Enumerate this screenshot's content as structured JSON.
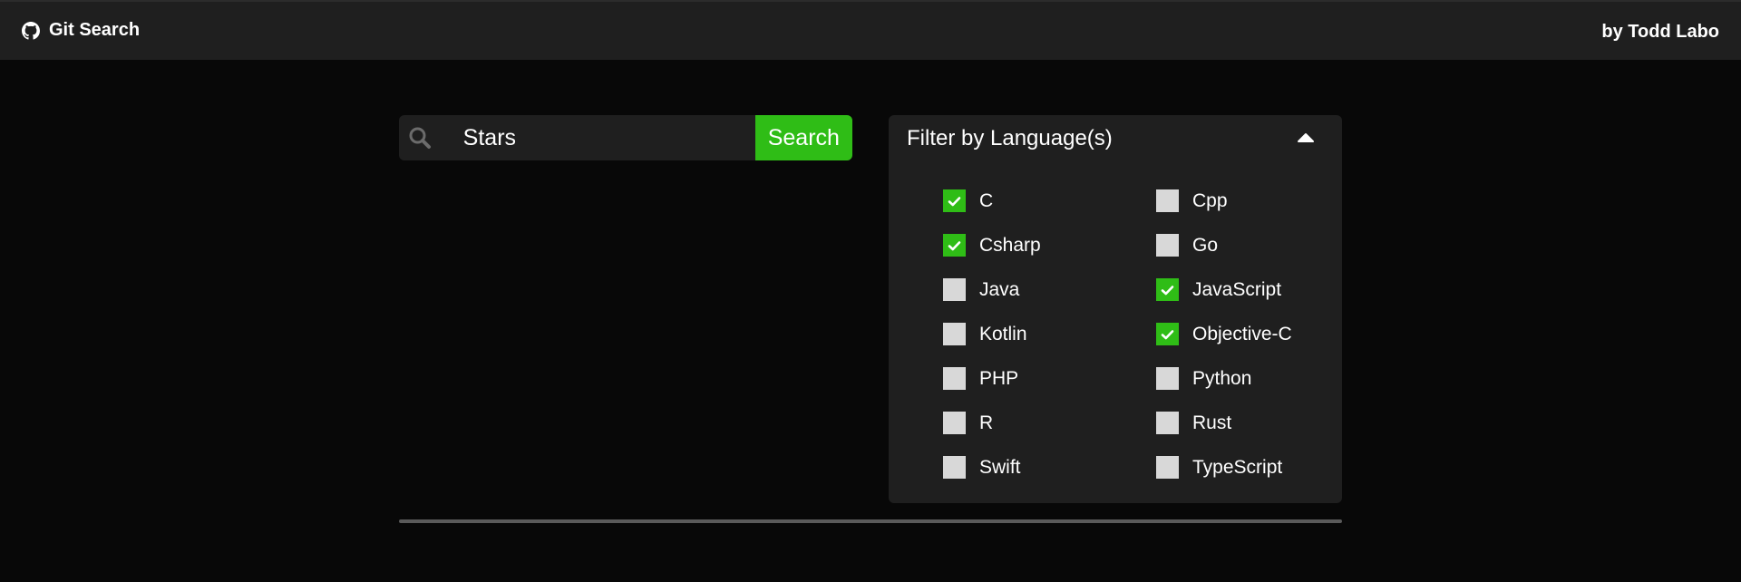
{
  "header": {
    "brand_icon": "github-icon",
    "title": "Git Search",
    "author": "by Todd Labo"
  },
  "search": {
    "icon": "search-icon",
    "value": "Stars",
    "placeholder": "",
    "button_label": "Search"
  },
  "filter": {
    "title": "Filter by Language(s)",
    "toggle_icon": "caret-up-icon",
    "expanded": true,
    "languages": [
      {
        "label": "C",
        "checked": true
      },
      {
        "label": "Cpp",
        "checked": false
      },
      {
        "label": "Csharp",
        "checked": true
      },
      {
        "label": "Go",
        "checked": false
      },
      {
        "label": "Java",
        "checked": false
      },
      {
        "label": "JavaScript",
        "checked": true
      },
      {
        "label": "Kotlin",
        "checked": false
      },
      {
        "label": "Objective-C",
        "checked": true
      },
      {
        "label": "PHP",
        "checked": false
      },
      {
        "label": "Python",
        "checked": false
      },
      {
        "label": "R",
        "checked": false
      },
      {
        "label": "Rust",
        "checked": false
      },
      {
        "label": "Swift",
        "checked": false
      },
      {
        "label": "TypeScript",
        "checked": false
      }
    ]
  },
  "colors": {
    "accent": "#2fbd16",
    "background": "#080808",
    "panel": "#1f1f1f",
    "checkbox_unchecked": "#d8d8d8"
  }
}
